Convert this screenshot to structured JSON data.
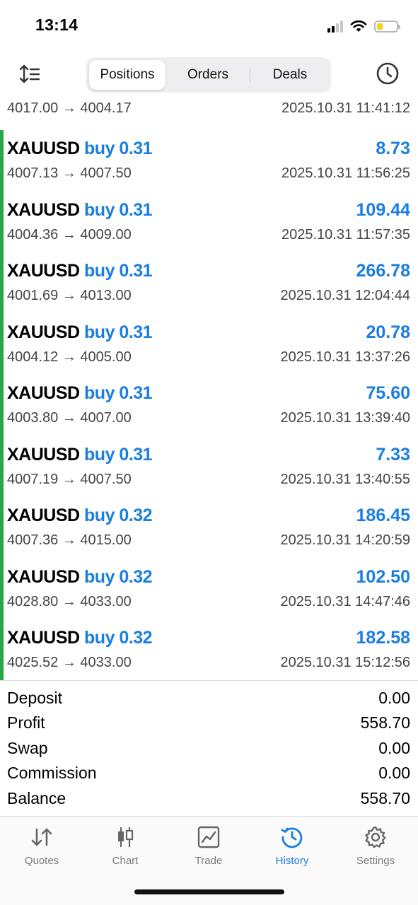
{
  "status": {
    "time": "13:14",
    "icons": [
      "signal-icon",
      "wifi-icon",
      "battery-icon"
    ]
  },
  "toolbar": {
    "sort_icon": "sort-icon",
    "history_icon": "clock-icon",
    "tabs": [
      {
        "label": "Positions",
        "active": true
      },
      {
        "label": "Orders",
        "active": false
      },
      {
        "label": "Deals",
        "active": false
      }
    ]
  },
  "partial_row": {
    "prices": "4017.00 → 4004.17",
    "datetime": "2025.10.31 11:41:12"
  },
  "deals": [
    {
      "symbol": "XAUUSD",
      "side": "buy 0.31",
      "profit": "8.73",
      "prices": "4007.13 → 4007.50",
      "datetime": "2025.10.31 11:56:25"
    },
    {
      "symbol": "XAUUSD",
      "side": "buy 0.31",
      "profit": "109.44",
      "prices": "4004.36 → 4009.00",
      "datetime": "2025.10.31 11:57:35"
    },
    {
      "symbol": "XAUUSD",
      "side": "buy 0.31",
      "profit": "266.78",
      "prices": "4001.69 → 4013.00",
      "datetime": "2025.10.31 12:04:44"
    },
    {
      "symbol": "XAUUSD",
      "side": "buy 0.31",
      "profit": "20.78",
      "prices": "4004.12 → 4005.00",
      "datetime": "2025.10.31 13:37:26"
    },
    {
      "symbol": "XAUUSD",
      "side": "buy 0.31",
      "profit": "75.60",
      "prices": "4003.80 → 4007.00",
      "datetime": "2025.10.31 13:39:40"
    },
    {
      "symbol": "XAUUSD",
      "side": "buy 0.31",
      "profit": "7.33",
      "prices": "4007.19 → 4007.50",
      "datetime": "2025.10.31 13:40:55"
    },
    {
      "symbol": "XAUUSD",
      "side": "buy 0.32",
      "profit": "186.45",
      "prices": "4007.36 → 4015.00",
      "datetime": "2025.10.31 14:20:59"
    },
    {
      "symbol": "XAUUSD",
      "side": "buy 0.32",
      "profit": "102.50",
      "prices": "4028.80 → 4033.00",
      "datetime": "2025.10.31 14:47:46"
    },
    {
      "symbol": "XAUUSD",
      "side": "buy 0.32",
      "profit": "182.58",
      "prices": "4025.52 → 4033.00",
      "datetime": "2025.10.31 15:12:56"
    }
  ],
  "summary": [
    {
      "label": "Deposit",
      "value": "0.00"
    },
    {
      "label": "Profit",
      "value": "558.70"
    },
    {
      "label": "Swap",
      "value": "0.00"
    },
    {
      "label": "Commission",
      "value": "0.00"
    },
    {
      "label": "Balance",
      "value": "558.70"
    }
  ],
  "tabbar": [
    {
      "label": "Quotes",
      "icon": "quotes-icon",
      "active": false
    },
    {
      "label": "Chart",
      "icon": "candlestick-icon",
      "active": false
    },
    {
      "label": "Trade",
      "icon": "trade-chart-icon",
      "active": false
    },
    {
      "label": "History",
      "icon": "history-icon",
      "active": true
    },
    {
      "label": "Settings",
      "icon": "gear-icon",
      "active": false
    }
  ],
  "colors": {
    "accent_blue": "#1a7ee0",
    "profit_bar_green": "#28a745",
    "inactive_gray": "#7a7a7a"
  }
}
